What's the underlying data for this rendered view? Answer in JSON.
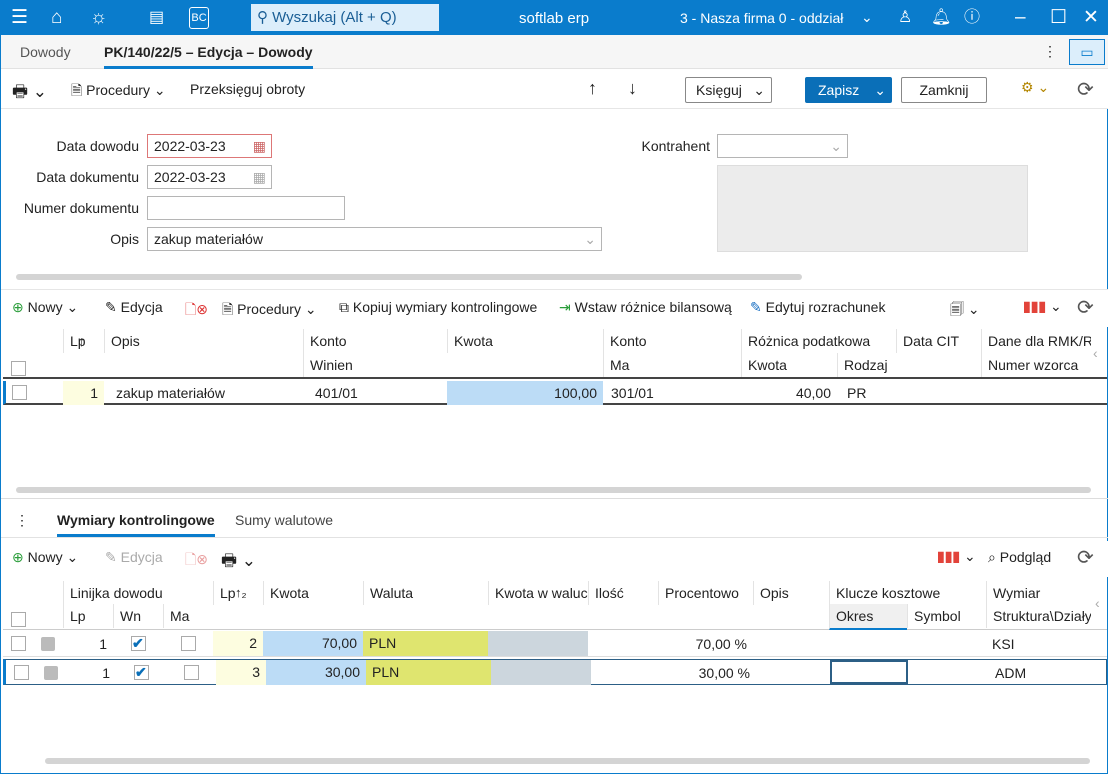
{
  "titlebar": {
    "search_placeholder": "Wyszukaj (Alt + Q)",
    "app_name": "softlab erp",
    "company": "3 - Nasza firma 0 - oddział",
    "accent": "#0a7ccc"
  },
  "tabs": [
    {
      "label": "Dowody"
    },
    {
      "label": "PK/140/22/5 – Edycja – Dowody"
    }
  ],
  "toolbar": {
    "procedures": "Procedury",
    "przeksieguj": "Przeksięguj obroty",
    "ksieguj": "Księguj",
    "save": "Zapisz",
    "close": "Zamknij"
  },
  "form": {
    "data_dowodu_label": "Data dowodu",
    "data_dowodu": "2022-03-23",
    "data_dokumentu_label": "Data dokumentu",
    "data_dokumentu": "2022-03-23",
    "numer_label": "Numer dokumentu",
    "numer": "",
    "opis_label": "Opis",
    "opis": "zakup materiałów",
    "kontrahent_label": "Kontrahent",
    "kontrahent": ""
  },
  "toolbar2": {
    "new": "Nowy",
    "edit": "Edycja",
    "procedures": "Procedury",
    "copy_dims": "Kopiuj wymiary kontrolingowe",
    "insert_diff": "Wstaw różnice bilansową",
    "edit_settlement": "Edytuj rozrachunek"
  },
  "grid1": {
    "headers_top": [
      "Lp",
      "Opis",
      "Konto",
      "Kwota",
      "Konto",
      "Różnica podatkowa",
      "Data CIT",
      "Dane dla RMK/R"
    ],
    "headers_bottom": [
      "Winien",
      "Ma",
      "Kwota",
      "Rodzaj",
      "Numer wzorca"
    ],
    "rows": [
      {
        "lp": "1",
        "opis": "zakup materiałów",
        "winien": "401/01",
        "kwota": "100,00",
        "ma": "301/01",
        "roznica_kwota": "40,00",
        "rodzaj": "PR"
      }
    ]
  },
  "bottom_tabs": [
    {
      "label": "Wymiary kontrolingowe"
    },
    {
      "label": "Sumy walutowe"
    }
  ],
  "toolbar3": {
    "new": "Nowy",
    "edit": "Edycja",
    "preview": "Podgląd"
  },
  "grid2": {
    "headers_top": [
      "Linijka dowodu",
      "Lp",
      "Kwota",
      "Waluta",
      "Kwota w walucie",
      "Ilość",
      "Procentowo",
      "Opis",
      "Klucze kosztowe",
      "Wymiar"
    ],
    "headers_bottom": [
      "Lp",
      "Wn",
      "Ma",
      "Okres",
      "Symbol",
      "Struktura\\Działy"
    ],
    "rows": [
      {
        "line_lp": "1",
        "wn": true,
        "ma": false,
        "lp": "2",
        "kwota": "70,00",
        "waluta": "PLN",
        "procent": "70,00 %",
        "struktura": "KSI"
      },
      {
        "line_lp": "1",
        "wn": true,
        "ma": false,
        "lp": "3",
        "kwota": "30,00",
        "waluta": "PLN",
        "procent": "30,00 %",
        "struktura": "ADM"
      }
    ]
  }
}
